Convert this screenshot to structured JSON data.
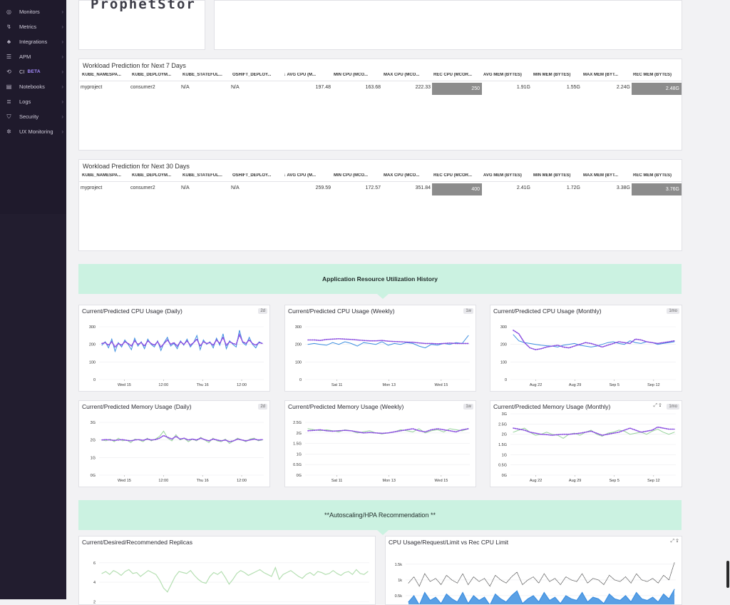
{
  "sidebar": {
    "items": [
      {
        "label": "Monitors",
        "icon": "monitors-icon",
        "top": 6
      },
      {
        "label": "Metrics",
        "icon": "metrics-icon",
        "top": 27
      },
      {
        "label": "Integrations",
        "icon": "integrations-icon",
        "top": 48
      },
      {
        "label": "APM",
        "icon": "apm-icon",
        "top": 69
      },
      {
        "label": "CI",
        "icon": "ci-icon",
        "top": 90,
        "badge": "BETA"
      },
      {
        "label": "Notebooks",
        "icon": "notebooks-icon",
        "top": 111
      },
      {
        "label": "Logs",
        "icon": "logs-icon",
        "top": 132
      },
      {
        "label": "Security",
        "icon": "security-icon",
        "top": 153
      },
      {
        "label": "UX Monitoring",
        "icon": "ux-monitoring-icon",
        "top": 174
      }
    ]
  },
  "logo": {
    "text": "ProphetStor"
  },
  "tables": [
    {
      "title": "Workload Prediction for Next 7 Days",
      "headers": [
        "KUBE_NAMESPA...",
        "KUBE_DEPLOYM...",
        "KUBE_STATEFUL...",
        "OSHIFT_DEPLOY...",
        "↓ AVG CPU (M...",
        "MIN CPU (MCO...",
        "MAX CPU (MCO...",
        "REC CPU (MCOR...",
        "AVG MEM (BYTES)",
        "MIN MEM (BYTES)",
        "MAX MEM (BYT...",
        "REC MEM (BYTES)"
      ],
      "row": [
        "myproject",
        "consumer2",
        "N/A",
        "N/A",
        "197.48",
        "163.68",
        "222.33",
        "250",
        "1.91G",
        "1.55G",
        "2.24G",
        "2.48G"
      ]
    },
    {
      "title": "Workload Prediction for Next 30 Days",
      "headers": [
        "KUBE_NAMESPA...",
        "KUBE_DEPLOYM...",
        "KUBE_STATEFUL...",
        "OSHIFT_DEPLOY...",
        "↓ AVG CPU (M...",
        "MIN CPU (MCO...",
        "MAX CPU (MCO...",
        "REC CPU (MCOR...",
        "AVG MEM (BYTES)",
        "MIN MEM (BYTES)",
        "MAX MEM (BYT...",
        "REC MEM (BYTES)"
      ],
      "row": [
        "myproject",
        "consumer2",
        "N/A",
        "N/A",
        "259.59",
        "172.57",
        "351.84",
        "400",
        "2.41G",
        "1.72G",
        "3.38G",
        "3.76G"
      ]
    }
  ],
  "banners": [
    "Application Resource Utilization History",
    "**Autoscaling/HPA Recommendation **"
  ],
  "colors": {
    "current": "#3d8fe0",
    "predicted": "#8a4de0",
    "memory_current": "#96d39a",
    "replicas": "#b5dfb2",
    "cpu_limit": "#555555",
    "highlight": "#8c8c8c",
    "banner": "#cbf2e1"
  },
  "charts": [
    {
      "title": "Current/Predicted CPU Usage (Daily)",
      "badge": "2d"
    },
    {
      "title": "Current/Predicted CPU Usage (Weekly)",
      "badge": "1w"
    },
    {
      "title": "Current/Predicted CPU Usage (Monthly)",
      "badge": "1mo"
    },
    {
      "title": "Current/Predicted Memory Usage (Daily)",
      "badge": "2d"
    },
    {
      "title": "Current/Predicted Memory Usage (Weekly)",
      "badge": "1w"
    },
    {
      "title": "Current/Predicted Memory Usage (Monthly)",
      "badge": "1mo"
    },
    {
      "title": "Current/Desired/Recommended Replicas",
      "badge": ""
    },
    {
      "title": "CPU Usage/Request/Limit vs Rec CPU Limit",
      "badge": ""
    }
  ],
  "chart_data": [
    {
      "type": "line",
      "title": "Current/Predicted CPU Usage (Daily)",
      "x_ticks": [
        "Wed 15",
        "12:00",
        "Thu 16",
        "12:00"
      ],
      "y_ticks": [
        "0",
        "100",
        "200",
        "300"
      ],
      "ylim": [
        0,
        300
      ],
      "series": [
        {
          "values": [
            195,
            215,
            180,
            230,
            160,
            210,
            185,
            225,
            200,
            170,
            235,
            190,
            215,
            175,
            230,
            200,
            185,
            220,
            165,
            210,
            240,
            190,
            205,
            175,
            220,
            195,
            230,
            185,
            210,
            250,
            170,
            225,
            200,
            215,
            180,
            235,
            195,
            260,
            175,
            220,
            200,
            185,
            280,
            210,
            195,
            240,
            200,
            180,
            215,
            205
          ]
        },
        {
          "values": [
            205,
            210,
            195,
            215,
            185,
            205,
            195,
            215,
            205,
            190,
            220,
            200,
            210,
            190,
            220,
            205,
            195,
            215,
            185,
            205,
            225,
            200,
            210,
            190,
            215,
            200,
            220,
            195,
            210,
            230,
            190,
            215,
            205,
            210,
            195,
            225,
            205,
            240,
            195,
            215,
            205,
            200,
            255,
            215,
            205,
            225,
            205,
            195,
            210,
            205
          ]
        }
      ]
    },
    {
      "type": "line",
      "title": "Current/Predicted CPU Usage (Weekly)",
      "x_ticks": [
        "Sat 11",
        "Mon 13",
        "Wed 15"
      ],
      "y_ticks": [
        "0",
        "100",
        "200",
        "300"
      ],
      "ylim": [
        0,
        300
      ],
      "series": [
        {
          "values": [
            200,
            205,
            200,
            195,
            210,
            200,
            215,
            205,
            190,
            210,
            205,
            200,
            215,
            195,
            205,
            200,
            210,
            205,
            190,
            180,
            200,
            195,
            205,
            200,
            210,
            205,
            250
          ]
        },
        {
          "values": [
            225,
            225,
            222,
            228,
            230,
            232,
            230,
            228,
            225,
            222,
            220,
            220,
            222,
            218,
            216,
            215,
            213,
            212,
            208,
            205,
            205,
            203,
            205,
            207,
            205,
            205,
            205
          ]
        }
      ]
    },
    {
      "type": "line",
      "title": "Current/Predicted CPU Usage (Monthly)",
      "x_ticks": [
        "Aug 22",
        "Aug 29",
        "Sep 5",
        "Sep 12"
      ],
      "y_ticks": [
        "0",
        "100",
        "200",
        "300"
      ],
      "ylim": [
        0,
        300
      ],
      "series": [
        {
          "values": [
            255,
            220,
            210,
            205,
            200,
            195,
            192,
            190,
            185,
            195,
            200,
            205,
            195,
            190,
            185,
            190,
            200,
            210,
            215,
            205,
            200,
            220,
            210,
            205,
            215,
            210,
            200,
            205,
            210,
            215
          ]
        },
        {
          "values": [
            280,
            260,
            210,
            180,
            170,
            175,
            185,
            190,
            195,
            185,
            180,
            190,
            200,
            210,
            205,
            195,
            185,
            195,
            205,
            215,
            210,
            205,
            230,
            225,
            215,
            210,
            205,
            210,
            215,
            220
          ]
        }
      ]
    },
    {
      "type": "line",
      "title": "Current/Predicted Memory Usage (Daily)",
      "x_ticks": [
        "Wed 15",
        "12:00",
        "Thu 16",
        "12:00"
      ],
      "y_ticks": [
        "0G",
        "1G",
        "2G",
        "3G"
      ],
      "ylim": [
        0,
        3
      ],
      "series": [
        {
          "values": [
            2.0,
            1.95,
            2.05,
            1.9,
            2.1,
            1.95,
            2.0,
            1.85,
            2.05,
            2.0,
            1.9,
            2.1,
            1.95,
            2.05,
            2.2,
            2.5,
            2.1,
            1.95,
            2.3,
            2.0,
            2.1,
            1.9,
            2.05,
            1.95,
            2.15,
            2.0,
            1.85,
            2.1,
            1.95,
            1.9,
            2.05,
            1.8,
            1.95,
            2.1,
            2.0,
            1.9,
            2.05,
            2.1,
            1.95,
            2.0
          ]
        },
        {
          "values": [
            2.0,
            2.02,
            2.0,
            1.98,
            2.0,
            2.02,
            1.98,
            1.95,
            2.0,
            2.02,
            1.98,
            2.05,
            2.0,
            2.02,
            2.1,
            2.25,
            2.15,
            2.05,
            2.2,
            2.05,
            2.1,
            2.0,
            2.05,
            2.0,
            2.1,
            2.02,
            1.95,
            2.05,
            2.0,
            1.95,
            2.0,
            1.9,
            1.95,
            2.05,
            2.0,
            1.95,
            2.0,
            2.05,
            2.0,
            2.02
          ]
        }
      ]
    },
    {
      "type": "line",
      "title": "Current/Predicted Memory Usage (Weekly)",
      "x_ticks": [
        "Sat 11",
        "Mon 13",
        "Wed 15"
      ],
      "y_ticks": [
        "0G",
        "0.5G",
        "1G",
        "1.5G",
        "2G",
        "2.5G"
      ],
      "ylim": [
        0,
        2.5
      ],
      "series": [
        {
          "values": [
            2.2,
            2.15,
            2.1,
            2.15,
            2.1,
            2.05,
            2.15,
            2.1,
            2.0,
            2.05,
            2.1,
            2.0,
            1.95,
            2.0,
            2.05,
            2.15,
            2.1,
            2.05,
            2.2,
            2.0,
            2.1,
            2.15,
            2.05,
            2.2,
            2.15,
            2.1,
            2.2
          ]
        },
        {
          "values": [
            2.1,
            2.12,
            2.15,
            2.1,
            2.08,
            2.1,
            2.12,
            2.1,
            2.05,
            2.0,
            2.02,
            2.0,
            1.98,
            2.0,
            2.05,
            2.1,
            2.15,
            2.2,
            2.1,
            2.05,
            2.15,
            2.2,
            2.15,
            2.1,
            2.05,
            2.15,
            2.2
          ]
        }
      ]
    },
    {
      "type": "line",
      "title": "Current/Predicted Memory Usage (Monthly)",
      "x_ticks": [
        "Aug 22",
        "Aug 29",
        "Sep 5",
        "Sep 12"
      ],
      "y_ticks": [
        "0G",
        "0.5G",
        "1G",
        "1.5G",
        "2G",
        "2.5G",
        "3G"
      ],
      "ylim": [
        0,
        3
      ],
      "series": [
        {
          "values": [
            2.1,
            2.2,
            2.3,
            2.1,
            1.95,
            2.0,
            2.1,
            2.0,
            1.95,
            1.8,
            2.0,
            2.05,
            1.95,
            2.1,
            2.2,
            2.0,
            1.9,
            2.05,
            2.1,
            2.2,
            2.15,
            2.0,
            2.05,
            2.1,
            2.0,
            2.15,
            2.25,
            2.1,
            2.0,
            2.1
          ]
        },
        {
          "values": [
            2.3,
            2.25,
            2.2,
            2.1,
            2.05,
            2.0,
            1.98,
            1.95,
            1.98,
            2.0,
            2.0,
            2.02,
            2.05,
            2.1,
            2.15,
            2.05,
            1.95,
            2.0,
            2.05,
            2.1,
            2.2,
            2.3,
            2.2,
            2.1,
            2.15,
            2.2,
            2.35,
            2.3,
            2.25,
            2.25
          ]
        }
      ]
    },
    {
      "type": "line",
      "title": "Current/Desired/Recommended Replicas",
      "x_ticks": [],
      "y_ticks": [
        "2",
        "4",
        "6"
      ],
      "ylim": [
        1,
        6.5
      ],
      "series": [
        {
          "values": [
            4.9,
            5.1,
            4.8,
            5.2,
            5.0,
            4.7,
            5.1,
            5.3,
            4.9,
            5.0,
            4.6,
            4.9,
            5.2,
            5.0,
            4.8,
            4.2,
            3.4,
            3.0,
            3.8,
            4.6,
            5.1,
            5.0,
            4.9,
            5.2,
            4.7,
            4.3,
            4.0,
            3.9,
            4.6,
            5.0,
            4.8,
            5.1,
            4.5,
            3.8,
            4.3,
            4.9,
            5.2,
            5.0,
            4.7,
            4.9,
            5.1,
            5.3,
            5.0,
            4.8,
            4.6,
            5.5,
            4.3,
            4.8,
            5.0,
            5.2,
            4.9,
            4.6,
            4.4,
            4.8,
            5.0,
            4.7,
            5.1,
            5.0,
            4.8,
            4.9,
            5.2,
            4.9,
            4.7,
            5.0,
            5.1,
            4.8,
            5.3,
            4.9,
            4.8,
            5.1
          ]
        }
      ]
    },
    {
      "type": "line",
      "title": "CPU Usage/Request/Limit vs Rec CPU Limit",
      "x_ticks": [],
      "y_ticks": [
        "0.5k",
        "1k",
        "1.5k"
      ],
      "ylim": [
        0,
        1.7
      ],
      "series": [
        {
          "values": [
            0.9,
            1.1,
            0.8,
            1.2,
            0.95,
            1.05,
            0.85,
            1.15,
            1.0,
            0.9,
            1.2,
            0.85,
            1.1,
            0.95,
            1.05,
            0.8,
            1.15,
            1.0,
            0.9,
            1.1,
            1.25,
            0.85,
            1.0,
            1.1,
            0.9,
            1.2,
            0.95,
            1.05,
            0.85,
            1.1,
            1.0,
            0.95,
            1.2,
            0.9,
            1.05,
            1.0,
            0.85,
            1.15,
            1.0,
            0.95,
            1.1,
            0.9,
            1.2,
            1.0,
            0.95,
            1.05,
            0.9,
            1.15,
            1.0,
            1.55
          ]
        },
        {
          "values": [
            0.3,
            0.5,
            0.2,
            0.6,
            0.35,
            0.45,
            0.25,
            0.55,
            0.4,
            0.3,
            0.6,
            0.25,
            0.5,
            0.35,
            0.45,
            0.2,
            0.55,
            0.4,
            0.3,
            0.5,
            0.65,
            0.25,
            0.4,
            0.5,
            0.3,
            0.6,
            0.35,
            0.45,
            0.25,
            0.5,
            0.4,
            0.35,
            0.6,
            0.3,
            0.45,
            0.4,
            0.25,
            0.55,
            0.4,
            0.35,
            0.5,
            0.3,
            0.6,
            0.4,
            0.35,
            0.45,
            0.3,
            0.55,
            0.4,
            0.7
          ]
        }
      ]
    }
  ]
}
